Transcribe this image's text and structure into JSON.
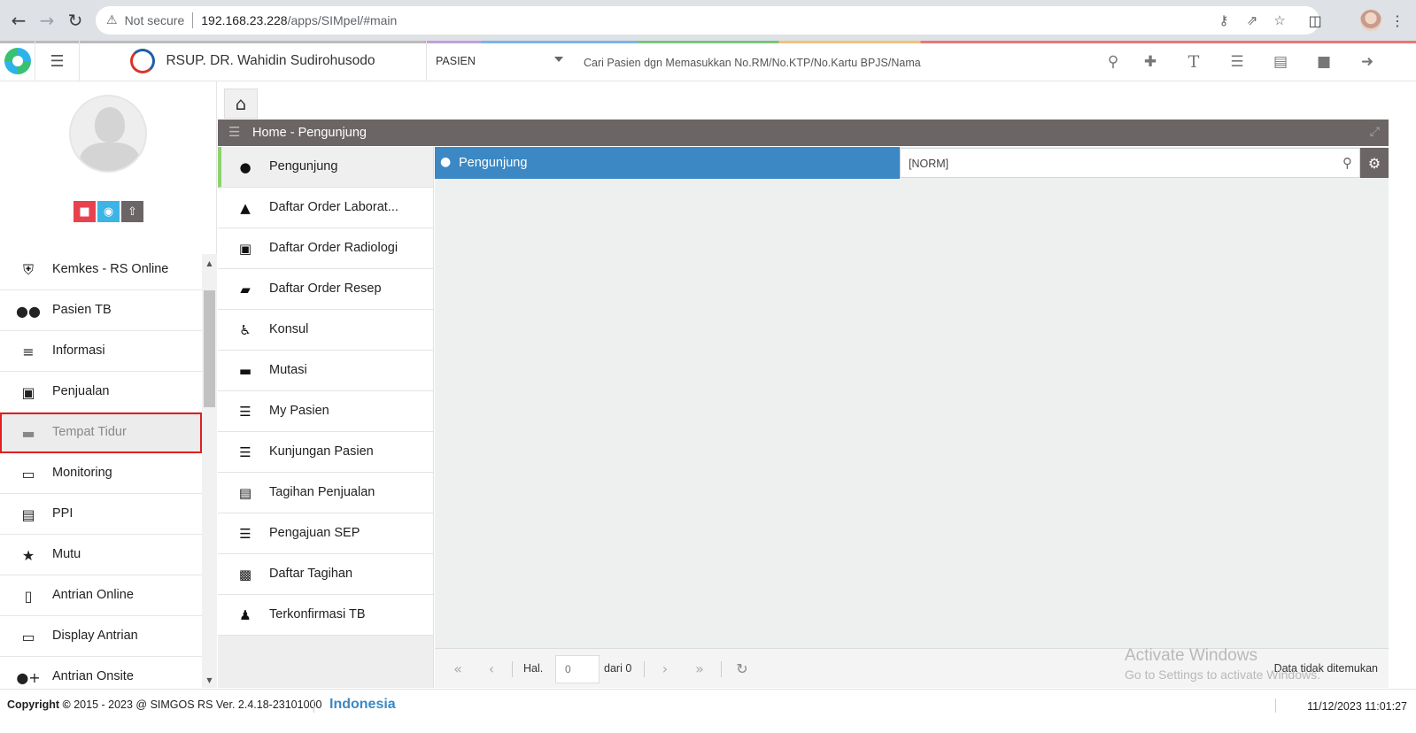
{
  "browser": {
    "security_label": "Not secure",
    "url_host": "192.168.23.228",
    "url_path": "/apps/SIMpel/#main",
    "icons": [
      "back-icon",
      "forward-icon",
      "reload-icon",
      "warning-icon",
      "key-icon",
      "share-icon",
      "star-icon",
      "sidepanel-icon",
      "profile-icon",
      "kebab-menu-icon"
    ]
  },
  "header": {
    "hospital_name": "RSUP. DR. Wahidin Sudirohusodo",
    "patient_type": "PASIEN",
    "search_placeholder": "Cari Pasien dgn Memasukkan No.RM/No.KTP/No.Kartu BPJS/Nama",
    "icons": [
      "search-icon",
      "add-user-icon",
      "text-icon",
      "list-icon",
      "pdf-icon",
      "folder-icon",
      "logout-icon"
    ]
  },
  "sidebar": {
    "avatar_buttons": [
      {
        "name": "lock",
        "color": "#e8424f"
      },
      {
        "name": "camera",
        "color": "#3cb4e6"
      },
      {
        "name": "upload",
        "color": "#6b6565"
      }
    ],
    "items": [
      {
        "label": "Kemkes - RS Online",
        "icon": "shield-icon"
      },
      {
        "label": "Pasien TB",
        "icon": "users-icon"
      },
      {
        "label": "Informasi",
        "icon": "database-icon"
      },
      {
        "label": "Penjualan",
        "icon": "cart-icon"
      },
      {
        "label": "Tempat Tidur",
        "icon": "bed-icon",
        "highlighted": true
      },
      {
        "label": "Monitoring",
        "icon": "monitor-icon"
      },
      {
        "label": "PPI",
        "icon": "newspaper-icon"
      },
      {
        "label": "Mutu",
        "icon": "child-icon"
      },
      {
        "label": "Antrian Online",
        "icon": "mobile-icon"
      },
      {
        "label": "Display Antrian",
        "icon": "tv-icon"
      },
      {
        "label": "Antrian Onsite",
        "icon": "user-plus-icon"
      }
    ]
  },
  "panel": {
    "title": "Home - Pengunjung"
  },
  "submenu": {
    "items": [
      {
        "label": "Pengunjung",
        "icon": "user-icon",
        "active": true
      },
      {
        "label": "Daftar Order Laborat...",
        "icon": "flask-icon"
      },
      {
        "label": "Daftar Order Radiologi",
        "icon": "xray-icon"
      },
      {
        "label": "Daftar Order Resep",
        "icon": "eraser-icon"
      },
      {
        "label": "Konsul",
        "icon": "wheelchair-icon"
      },
      {
        "label": "Mutasi",
        "icon": "bed-icon"
      },
      {
        "label": "My Pasien",
        "icon": "list-icon"
      },
      {
        "label": "Kunjungan Pasien",
        "icon": "list-icon"
      },
      {
        "label": "Tagihan Penjualan",
        "icon": "credit-card-icon"
      },
      {
        "label": "Pengajuan SEP",
        "icon": "list-icon"
      },
      {
        "label": "Daftar Tagihan",
        "icon": "money-icon"
      },
      {
        "label": "Terkonfirmasi TB",
        "icon": "user-nurse-icon"
      }
    ]
  },
  "content": {
    "title": "Pengunjung",
    "norm_placeholder": "[NORM]"
  },
  "pager": {
    "hal_label": "Hal.",
    "page_value": "0",
    "dari_label": "dari 0",
    "status": "Data tidak ditemukan"
  },
  "watermark": {
    "line1": "Activate Windows",
    "line2": "Go to Settings to activate Windows."
  },
  "footer": {
    "copyright": "Copyright",
    "years": "2015 - 2023 @ SIMGOS RS Ver. 2.4.18-23101000",
    "language": "Indonesia",
    "datetime": "11/12/2023 11:01:27"
  },
  "colors": {
    "primary_blue": "#3b88c4",
    "panel_gray": "#6b6565",
    "highlight_red": "#e41e1e",
    "active_green": "#8ed16f"
  }
}
